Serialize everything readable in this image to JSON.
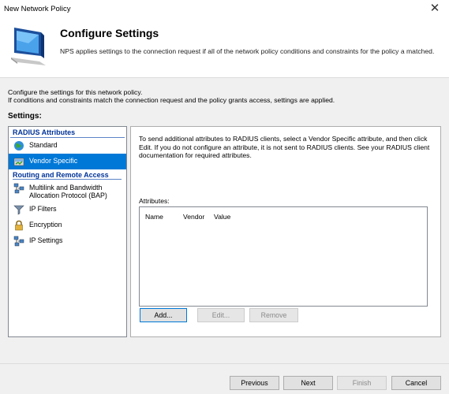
{
  "window": {
    "title": "New Network Policy",
    "close_glyph": "✕"
  },
  "header": {
    "title": "Configure Settings",
    "description": "NPS applies settings to the connection request if all of the network policy conditions and constraints for the policy a matched.",
    "icon": "monitor-icon"
  },
  "intro": {
    "line1": "Configure the settings for this network policy.",
    "line2": "If conditions and constraints match the connection request and the policy grants access, settings are applied."
  },
  "settings_label": "Settings:",
  "tree": {
    "category1": "RADIUS Attributes",
    "category2": "Routing and Remote Access",
    "items": [
      {
        "label": "Standard",
        "icon": "globe-icon"
      },
      {
        "label": "Vendor Specific",
        "icon": "server-icon"
      },
      {
        "label": "Multilink and Bandwidth Allocation Protocol (BAP)",
        "icon": "network-icon"
      },
      {
        "label": "IP Filters",
        "icon": "filter-icon"
      },
      {
        "label": "Encryption",
        "icon": "lock-icon"
      },
      {
        "label": "IP Settings",
        "icon": "network-icon"
      }
    ],
    "selected": "Vendor Specific"
  },
  "panel": {
    "description": "To send additional attributes to RADIUS clients, select a Vendor Specific attribute, and then click Edit. If you do not configure an attribute, it is not sent to RADIUS clients. See your RADIUS client documentation for required attributes.",
    "attributes_label": "Attributes:",
    "columns": [
      "Name",
      "Vendor",
      "Value"
    ],
    "rows": [],
    "buttons": {
      "add": "Add...",
      "edit": "Edit...",
      "remove": "Remove"
    }
  },
  "footer": {
    "previous": "Previous",
    "next": "Next",
    "finish": "Finish",
    "cancel": "Cancel"
  },
  "colors": {
    "selection": "#0078d7",
    "category": "#003399",
    "background": "#f0f0f0"
  }
}
